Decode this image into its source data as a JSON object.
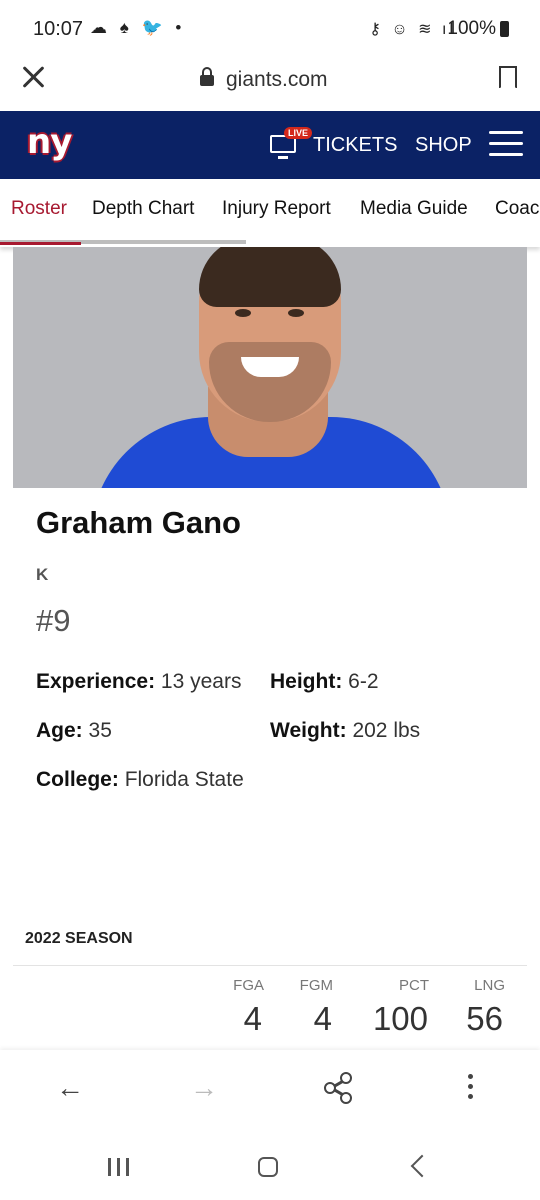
{
  "status_bar": {
    "time": "10:07",
    "left_icons": "☁ ♠ 🐦 •",
    "right_icons": "⚷ ☺ ≋ ıl",
    "battery": "100%"
  },
  "browser": {
    "url": "giants.com"
  },
  "site_header": {
    "logo": "ny",
    "live_badge": "LIVE",
    "tickets": "TICKETS",
    "shop": "SHOP"
  },
  "tabs": [
    {
      "label": "Roster",
      "active": true
    },
    {
      "label": "Depth Chart",
      "active": false
    },
    {
      "label": "Injury Report",
      "active": false
    },
    {
      "label": "Media Guide",
      "active": false
    },
    {
      "label": "Coac",
      "active": false
    }
  ],
  "player": {
    "name": "Graham Gano",
    "position": "K",
    "number": "#9",
    "experience_label": "Experience:",
    "experience": "13 years",
    "height_label": "Height:",
    "height": "6-2",
    "age_label": "Age:",
    "age": "35",
    "weight_label": "Weight:",
    "weight": "202 lbs",
    "college_label": "College:",
    "college": "Florida State"
  },
  "season": {
    "label": "2022 SEASON",
    "stats": [
      {
        "header": "FGA",
        "value": "4"
      },
      {
        "header": "FGM",
        "value": "4"
      },
      {
        "header": "PCT",
        "value": "100"
      },
      {
        "header": "LNG",
        "value": "56"
      }
    ]
  },
  "browser_nav": {
    "back": "←",
    "forward": "→"
  }
}
